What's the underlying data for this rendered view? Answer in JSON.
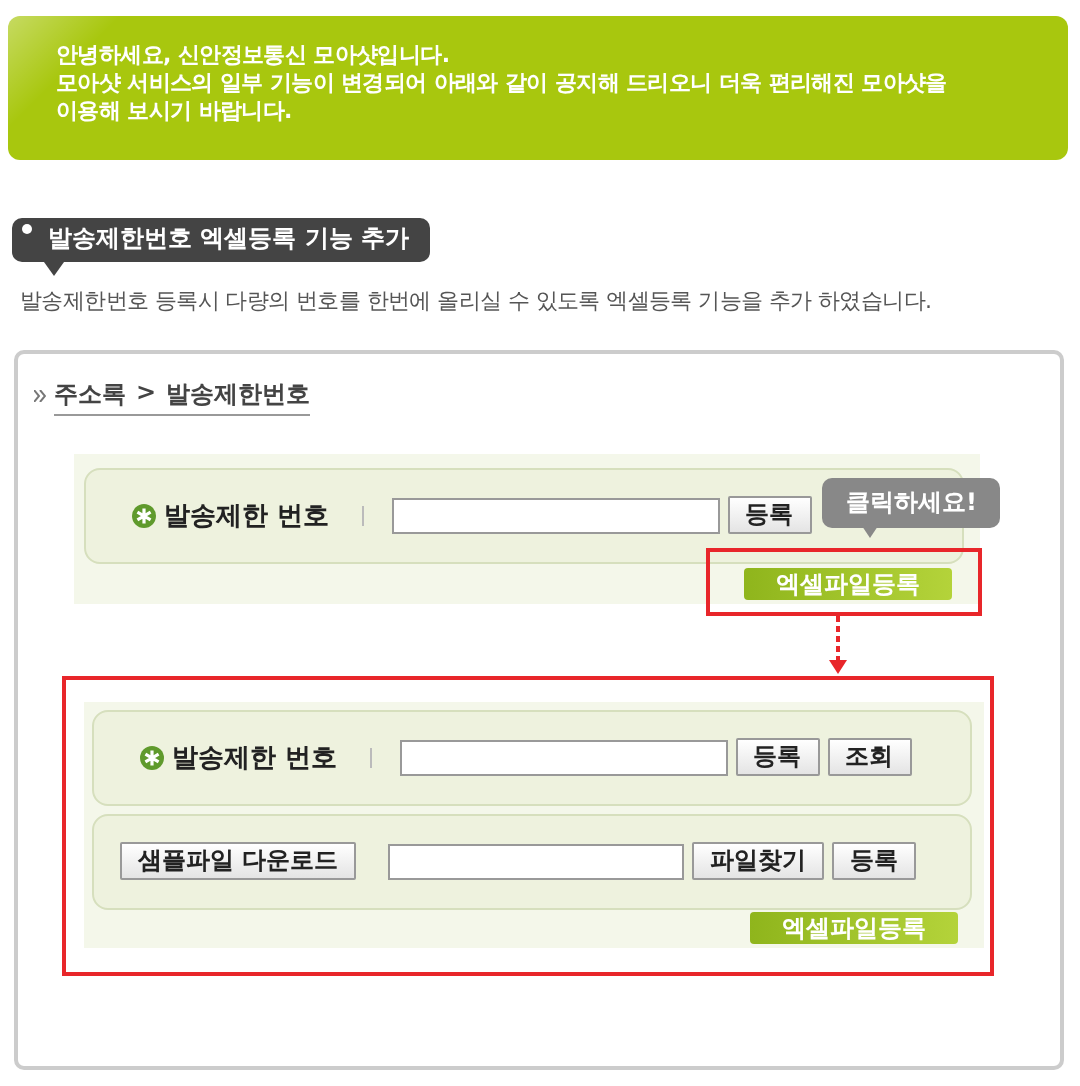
{
  "notice": {
    "lines": [
      "안녕하세요, 신안정보통신 모아샷입니다.",
      "모아샷 서비스의 일부 기능이 변경되어 아래와 같이 공지해 드리오니 더욱 편리해진 모아샷을",
      "이용해 보시기 바랍니다."
    ]
  },
  "section_title": "발송제한번호 엑셀등록 기능 추가",
  "description": "발송제한번호 등록시 다량의 번호를 한번에 올리실 수 있도록 엑셀등록 기능을 추가 하였습니다.",
  "breadcrumb": {
    "items": [
      "주소록",
      "발송제한번호"
    ],
    "separator": ">"
  },
  "before": {
    "label": "발송제한 번호",
    "buttons": [
      "등록"
    ],
    "tooltip": "클릭하세요!",
    "excel_button": "엑셀파일등록"
  },
  "after": {
    "rows": [
      {
        "kind": "label",
        "label": "발송제한 번호",
        "buttons": [
          "등록",
          "조회"
        ]
      },
      {
        "kind": "download",
        "download_button": "샘플파일 다운로드",
        "buttons": [
          "파일찾기",
          "등록"
        ]
      }
    ],
    "excel_button": "엑셀파일등록"
  }
}
